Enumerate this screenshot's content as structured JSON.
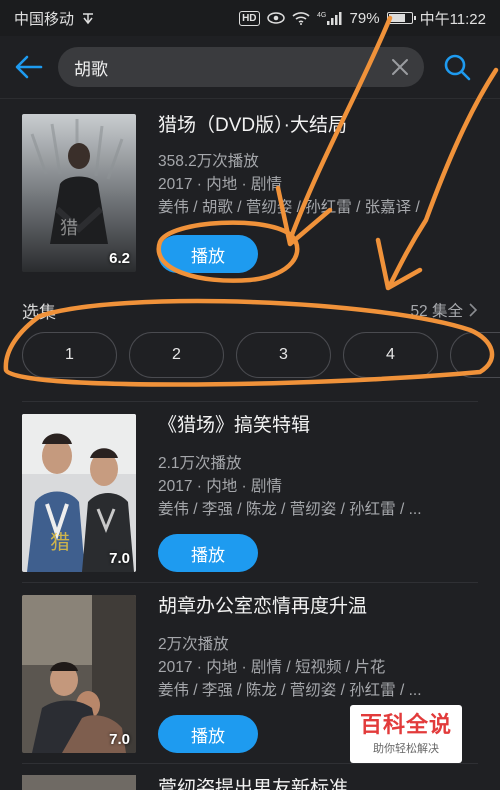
{
  "status_bar": {
    "carrier": "中国移动",
    "network": "4G",
    "battery": "79%",
    "battery_level": 0.79,
    "time": "中午11:22"
  },
  "search": {
    "query": "胡歌"
  },
  "results": [
    {
      "title": "猎场（DVD版）·大结局",
      "plays": "358.2万次播放",
      "meta": "2017 · 内地 · 剧情",
      "cast": "姜伟 / 胡歌 / 菅纫姿 / 孙红雷 / 张嘉译 /",
      "rating": "6.2",
      "play_label": "播放"
    },
    {
      "title": "《猎场》搞笑特辑",
      "plays": "2.1万次播放",
      "meta": "2017 · 内地 · 剧情",
      "cast": "姜伟 / 李强 / 陈龙 / 菅纫姿 / 孙红雷 / ...",
      "rating": "7.0",
      "play_label": "播放"
    },
    {
      "title": "胡章办公室恋情再度升温",
      "plays": "2万次播放",
      "meta": "2017 · 内地 · 剧情 / 短视频 / 片花",
      "cast": "姜伟 / 李强 / 陈龙 / 菅纫姿 / 孙红雷 / ...",
      "rating": "7.0",
      "play_label": "播放"
    },
    {
      "title": "菅纫姿提出男友新标准"
    }
  ],
  "episodes": {
    "label": "选集",
    "total": "52 集全",
    "items": [
      "1",
      "2",
      "3",
      "4"
    ]
  },
  "watermark": {
    "title": "百科全说",
    "subtitle": "助你轻松解决"
  },
  "colors": {
    "accent": "#1e9bf0",
    "annotation": "#f0923a",
    "background": "#1f2023"
  }
}
